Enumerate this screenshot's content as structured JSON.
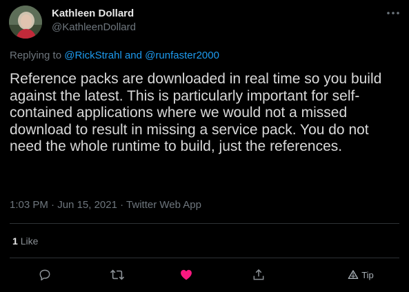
{
  "author": {
    "name": "Kathleen Dollard",
    "handle": "@KathleenDollard"
  },
  "reply": {
    "prefix": "Replying to",
    "user1": "@RickStrahl",
    "joiner": "and",
    "user2": "@runfaster2000"
  },
  "tweet": {
    "text": "Reference packs are downloaded in real time so you build against the latest. This is particularly important for self-contained applications where we would not a missed download to result in missing a service pack. You do not need the whole runtime to build, just the references.",
    "time": "1:03 PM",
    "date": "Jun 15, 2021",
    "source": "Twitter Web App"
  },
  "stats": {
    "likes_count": "1",
    "likes_label": "Like"
  },
  "actions": {
    "reply_icon": "comment-icon",
    "retweet_icon": "retweet-icon",
    "like_icon": "heart-icon",
    "share_icon": "share-icon",
    "tip_icon": "tip-icon",
    "tip_label": "Tip"
  },
  "colors": {
    "background": "#000000",
    "link": "#1d9bf0",
    "like": "#f91880",
    "muted": "#6e767d"
  }
}
